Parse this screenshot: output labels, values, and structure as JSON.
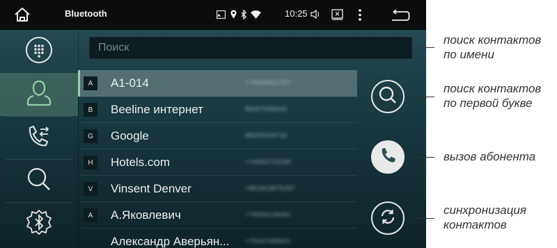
{
  "status_bar": {
    "app_title": "Bluetooth",
    "time": "10:25",
    "icons": [
      "home-icon",
      "cast-icon",
      "location-icon",
      "bluetooth-icon",
      "wifi-icon",
      "volume-icon",
      "screenshot-icon",
      "more-icon",
      "back-icon"
    ]
  },
  "sidebar": {
    "items": [
      {
        "name": "dialpad",
        "icon": "dialpad-icon",
        "active": false
      },
      {
        "name": "contacts",
        "icon": "contacts-icon",
        "active": true
      },
      {
        "name": "call-log",
        "icon": "call-log-icon",
        "active": false
      },
      {
        "name": "search",
        "icon": "search-icon",
        "active": false
      },
      {
        "name": "bluetooth-settings",
        "icon": "bluetooth-settings-icon",
        "active": false
      }
    ]
  },
  "search": {
    "placeholder": "Поиск"
  },
  "contacts": [
    {
      "letter": "A",
      "name": "A1-014",
      "phone": "+79259822757",
      "selected": true
    },
    {
      "letter": "B",
      "name": "Beeline интернет",
      "phone": "88007008000",
      "selected": false
    },
    {
      "letter": "G",
      "name": "Google",
      "phone": "88005009726",
      "selected": false
    },
    {
      "letter": "H",
      "name": "Hotels.com",
      "phone": "+74992722035",
      "selected": false
    },
    {
      "letter": "V",
      "name": "Vinsent Denver",
      "phone": "+861813875287",
      "selected": false
    },
    {
      "letter": "А",
      "name": "А.Яковлевич",
      "phone": "+79055135681",
      "selected": false
    },
    {
      "letter": "",
      "name": "Александр Аверьян...",
      "phone": "+79167489921",
      "selected": false
    }
  ],
  "actions": [
    {
      "name": "letter-search",
      "icon": "search-icon"
    },
    {
      "name": "call",
      "icon": "phone-icon"
    },
    {
      "name": "sync",
      "icon": "sync-icon"
    }
  ],
  "annotations": {
    "search_by_name": [
      "поиск контактов",
      "по имени"
    ],
    "search_by_letter": [
      "поиск контактов",
      "по первой букве"
    ],
    "call": [
      "вызов абонента"
    ],
    "sync": [
      "синхронизация",
      "контактов"
    ]
  },
  "colors": {
    "statusbar_bg": "#0a0c0d",
    "screen_bg_top": "#2b5158",
    "screen_bg_bottom": "#0f2429",
    "active_sidebar": "#58806e",
    "accent_green": "#9ad2b5",
    "annotation_text": "#333333"
  }
}
